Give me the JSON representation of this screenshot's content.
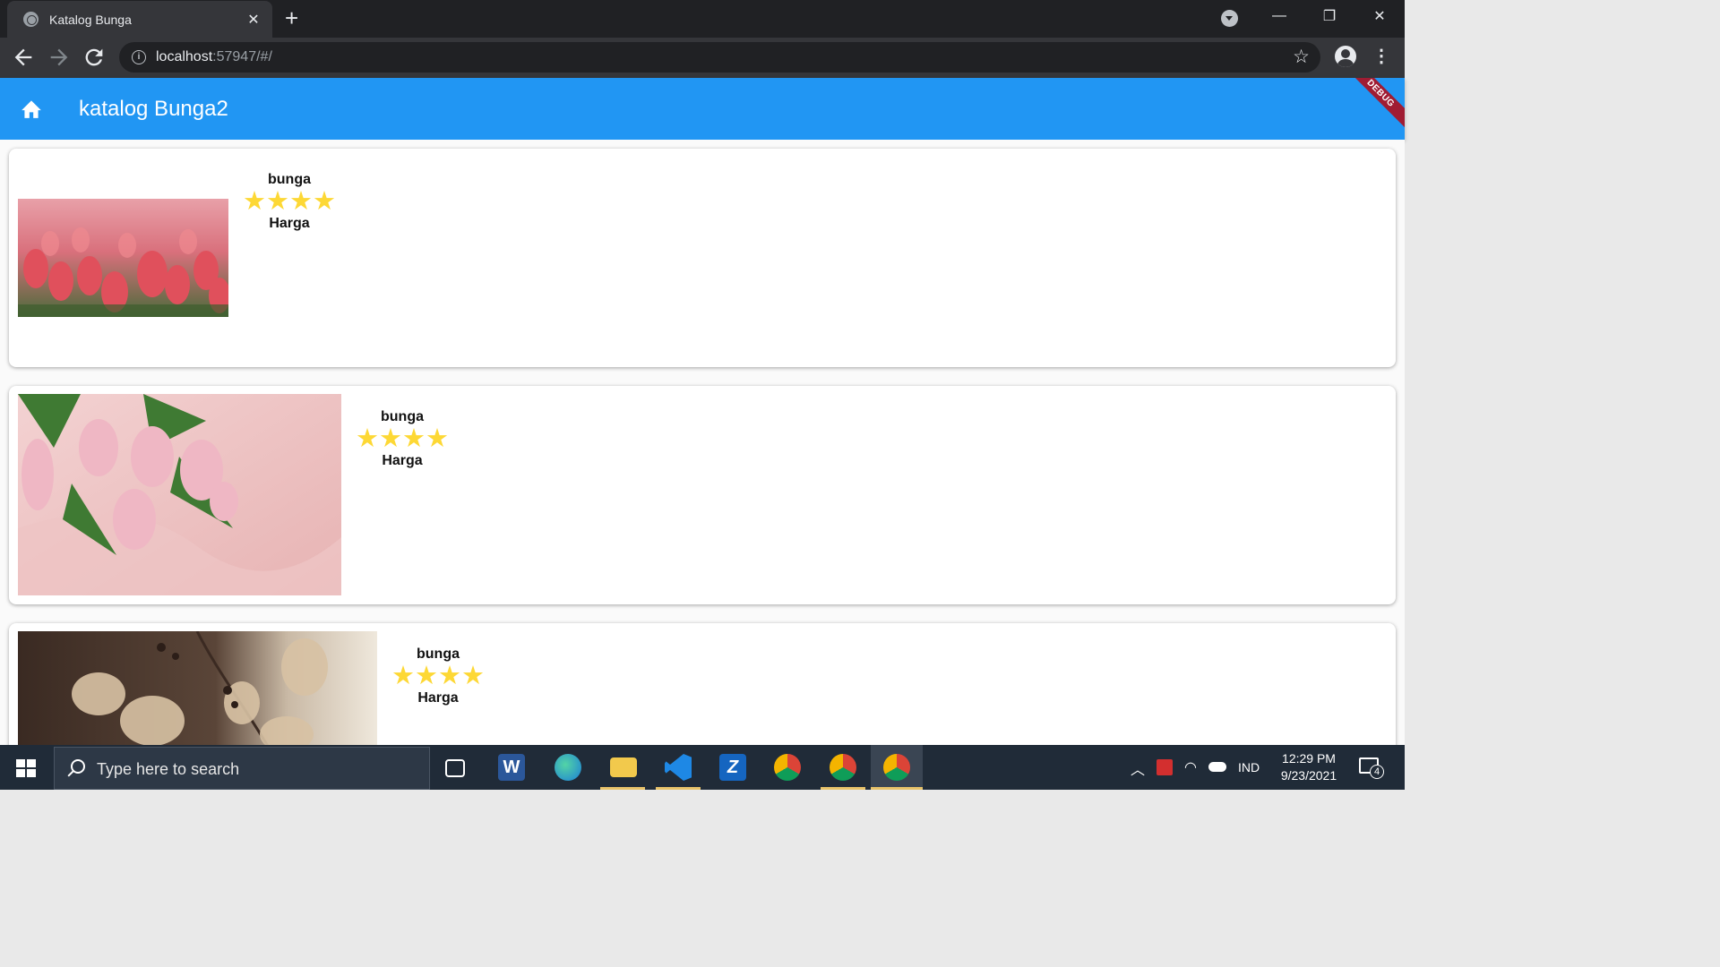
{
  "browser": {
    "tab_title": "Katalog Bunga",
    "tab_close": "✕",
    "new_tab": "+",
    "url_host": "localhost",
    "url_rest": ":57947/#/",
    "minimize": "—",
    "restore": "❐",
    "close": "✕"
  },
  "app": {
    "title": "katalog Bunga2",
    "debug_banner": "DEBUG",
    "brand_color": "#2196f3"
  },
  "items": [
    {
      "name": "bunga",
      "rating": 4,
      "rating_text": "★★★★",
      "price_label": "Harga",
      "image": "red-tulip-field"
    },
    {
      "name": "bunga",
      "rating": 4,
      "rating_text": "★★★★",
      "price_label": "Harga",
      "image": "pink-tulips-on-satin"
    },
    {
      "name": "bunga",
      "rating": 4,
      "rating_text": "★★★★",
      "price_label": "Harga",
      "image": "dried-hydrangea"
    }
  ],
  "taskbar": {
    "search_placeholder": "Type here to search",
    "language": "IND",
    "time": "12:29 PM",
    "date": "9/23/2021",
    "notifications": "4"
  }
}
